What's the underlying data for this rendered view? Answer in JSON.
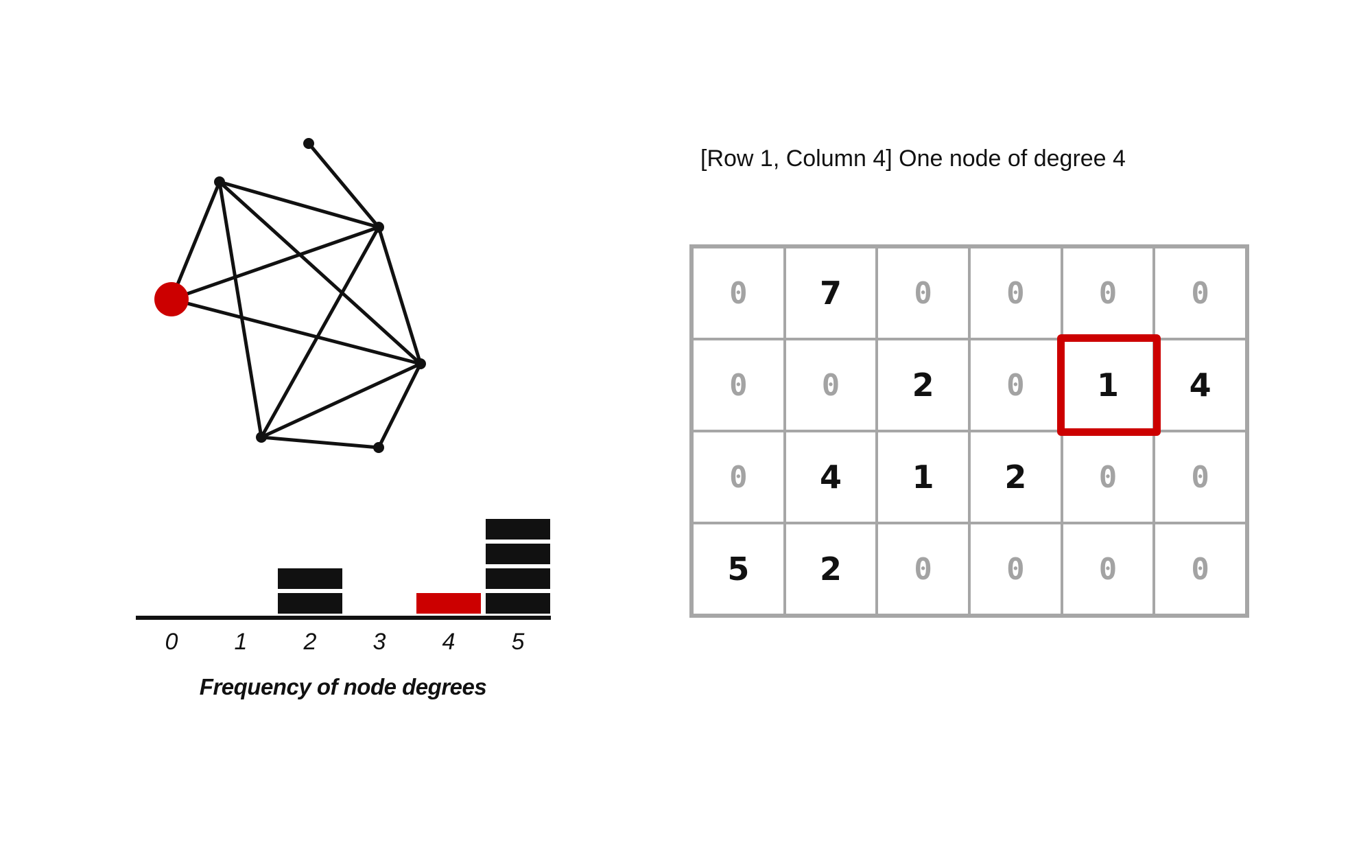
{
  "caption": "[Row 1, Column 4] One node of degree 4",
  "colors": {
    "highlight": "#cc0000",
    "edge": "#111111",
    "grid": "#a6a6a6",
    "zero_text": "#a3a3a3"
  },
  "graph": {
    "nodes": [
      {
        "id": "A",
        "highlighted": false
      },
      {
        "id": "B",
        "highlighted": false
      },
      {
        "id": "C",
        "highlighted": false
      },
      {
        "id": "D",
        "highlighted": true
      },
      {
        "id": "E",
        "highlighted": false
      },
      {
        "id": "F",
        "highlighted": false
      },
      {
        "id": "G",
        "highlighted": false
      }
    ],
    "edges": [
      [
        "A",
        "C"
      ],
      [
        "B",
        "C"
      ],
      [
        "B",
        "D"
      ],
      [
        "B",
        "E"
      ],
      [
        "B",
        "F"
      ],
      [
        "C",
        "D"
      ],
      [
        "C",
        "E"
      ],
      [
        "C",
        "F"
      ],
      [
        "D",
        "E"
      ],
      [
        "E",
        "F"
      ],
      [
        "E",
        "G"
      ],
      [
        "F",
        "G"
      ]
    ]
  },
  "histogram": {
    "title": "Frequency of node degrees",
    "degrees": [
      "0",
      "1",
      "2",
      "3",
      "4",
      "5"
    ],
    "counts": [
      0,
      0,
      2,
      0,
      1,
      4
    ],
    "highlighted_degree": "4"
  },
  "matrix": {
    "rows": [
      [
        0,
        7,
        0,
        0,
        0,
        0
      ],
      [
        0,
        0,
        2,
        0,
        1,
        4
      ],
      [
        0,
        4,
        1,
        2,
        0,
        0
      ],
      [
        5,
        2,
        0,
        0,
        0,
        0
      ]
    ],
    "highlighted_cell": {
      "row": 1,
      "column": 4
    }
  }
}
